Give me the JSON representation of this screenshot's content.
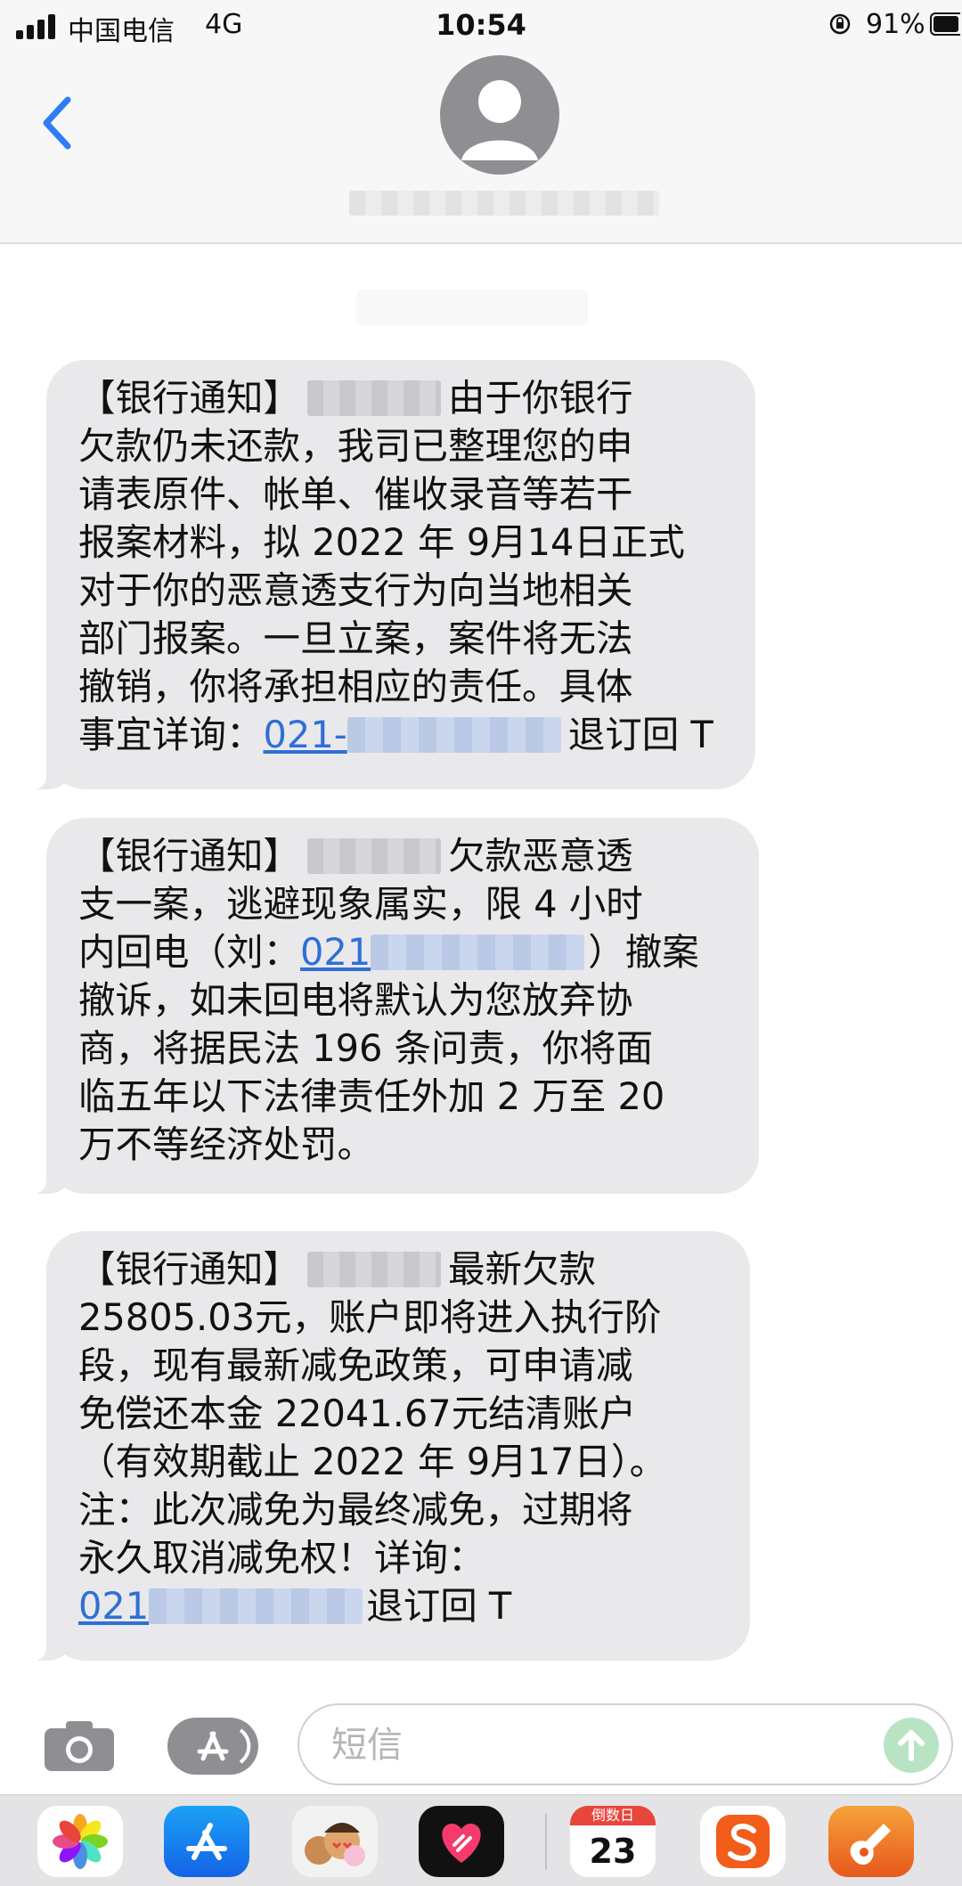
{
  "status_bar": {
    "carrier": "中国电信",
    "network": "4G",
    "time": "10:54",
    "battery": "91%"
  },
  "header": {
    "back": "back",
    "avatar": "contact-avatar"
  },
  "messages": [
    {
      "lines": [
        {
          "a": "【银行通知】",
          "b": "由于你银行"
        },
        {
          "t": "欠款仍未还款，我司已整理您的申"
        },
        {
          "t": "请表原件、帐单、催收录音等若干"
        },
        {
          "t": "报案材料，拟 2022 年 9月14日正式"
        },
        {
          "t": "对于你的恶意透支行为向当地相关"
        },
        {
          "t": "部门报案。一旦立案，案件将无法"
        },
        {
          "t": "撤销，你将承担相应的责任。具体"
        },
        {
          "pre": "事宜详询：",
          "link": "021-",
          "post": "退订回 T"
        }
      ]
    },
    {
      "lines": [
        {
          "a": "【银行通知】",
          "b": "欠款恶意透"
        },
        {
          "t": "支一案，逃避现象属实，限 4 小时"
        },
        {
          "pre": "内回电（刘：",
          "link": "021",
          "post": "）撤案"
        },
        {
          "t": "撤诉，如未回电将默认为您放弃协"
        },
        {
          "t": "商，将据民法 196 条问责，你将面"
        },
        {
          "t": "临五年以下法律责任外加 2 万至 20"
        },
        {
          "t": "万不等经济处罚。"
        }
      ]
    },
    {
      "lines": [
        {
          "a": "【银行通知】",
          "b": "最新欠款"
        },
        {
          "t": "25805.03元，账户即将进入执行阶"
        },
        {
          "t": "段，现有最新减免政策，可申请减"
        },
        {
          "t": "免偿还本金 22041.67元结清账户"
        },
        {
          "t": "（有效期截止 2022 年 9月17日）。"
        },
        {
          "t": "注：此次减免为最终减免，过期将"
        },
        {
          "t": "永久取消减免权！详询："
        },
        {
          "pre": "",
          "link": "021",
          "post": "退订回 T"
        }
      ]
    }
  ],
  "input": {
    "placeholder": "短信"
  },
  "drawer": {
    "apps": [
      "photos-icon",
      "app-store-icon",
      "memoji-icon",
      "digital-touch-icon",
      "countdown-icon",
      "sogou-icon",
      "garageband-icon"
    ],
    "countdown_label": "倒数日",
    "countdown_value": "23"
  }
}
